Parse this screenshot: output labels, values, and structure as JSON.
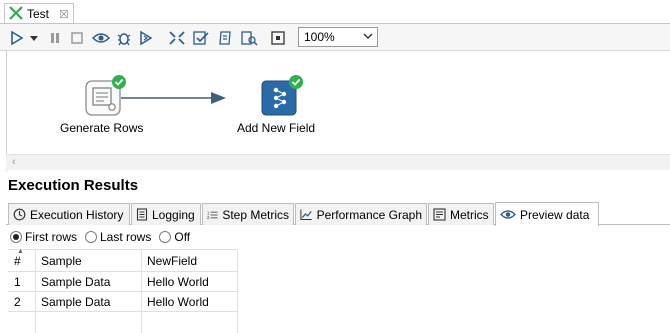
{
  "tab": {
    "title": "Test",
    "close": "☒"
  },
  "toolbar": {
    "zoom": "100%"
  },
  "steps": [
    {
      "label": "Generate Rows",
      "status": "success"
    },
    {
      "label": "Add New Field",
      "status": "success"
    }
  ],
  "results": {
    "title": "Execution Results",
    "tabs": [
      "Execution History",
      "Logging",
      "Step Metrics",
      "Performance Graph",
      "Metrics",
      "Preview data"
    ],
    "active_tab": "Preview data",
    "radios": [
      {
        "label": "First rows",
        "checked": true
      },
      {
        "label": "Last rows",
        "checked": false
      },
      {
        "label": "Off",
        "checked": false
      }
    ]
  },
  "table": {
    "headers": [
      "#",
      "Sample",
      "NewField"
    ],
    "rows": [
      [
        "1",
        "Sample Data",
        "Hello World"
      ],
      [
        "2",
        "Sample Data",
        "Hello World"
      ]
    ]
  },
  "colors": {
    "step_icon": "#2a6aa8",
    "check": "#2fb24a",
    "hop": "#3f5f7f"
  }
}
